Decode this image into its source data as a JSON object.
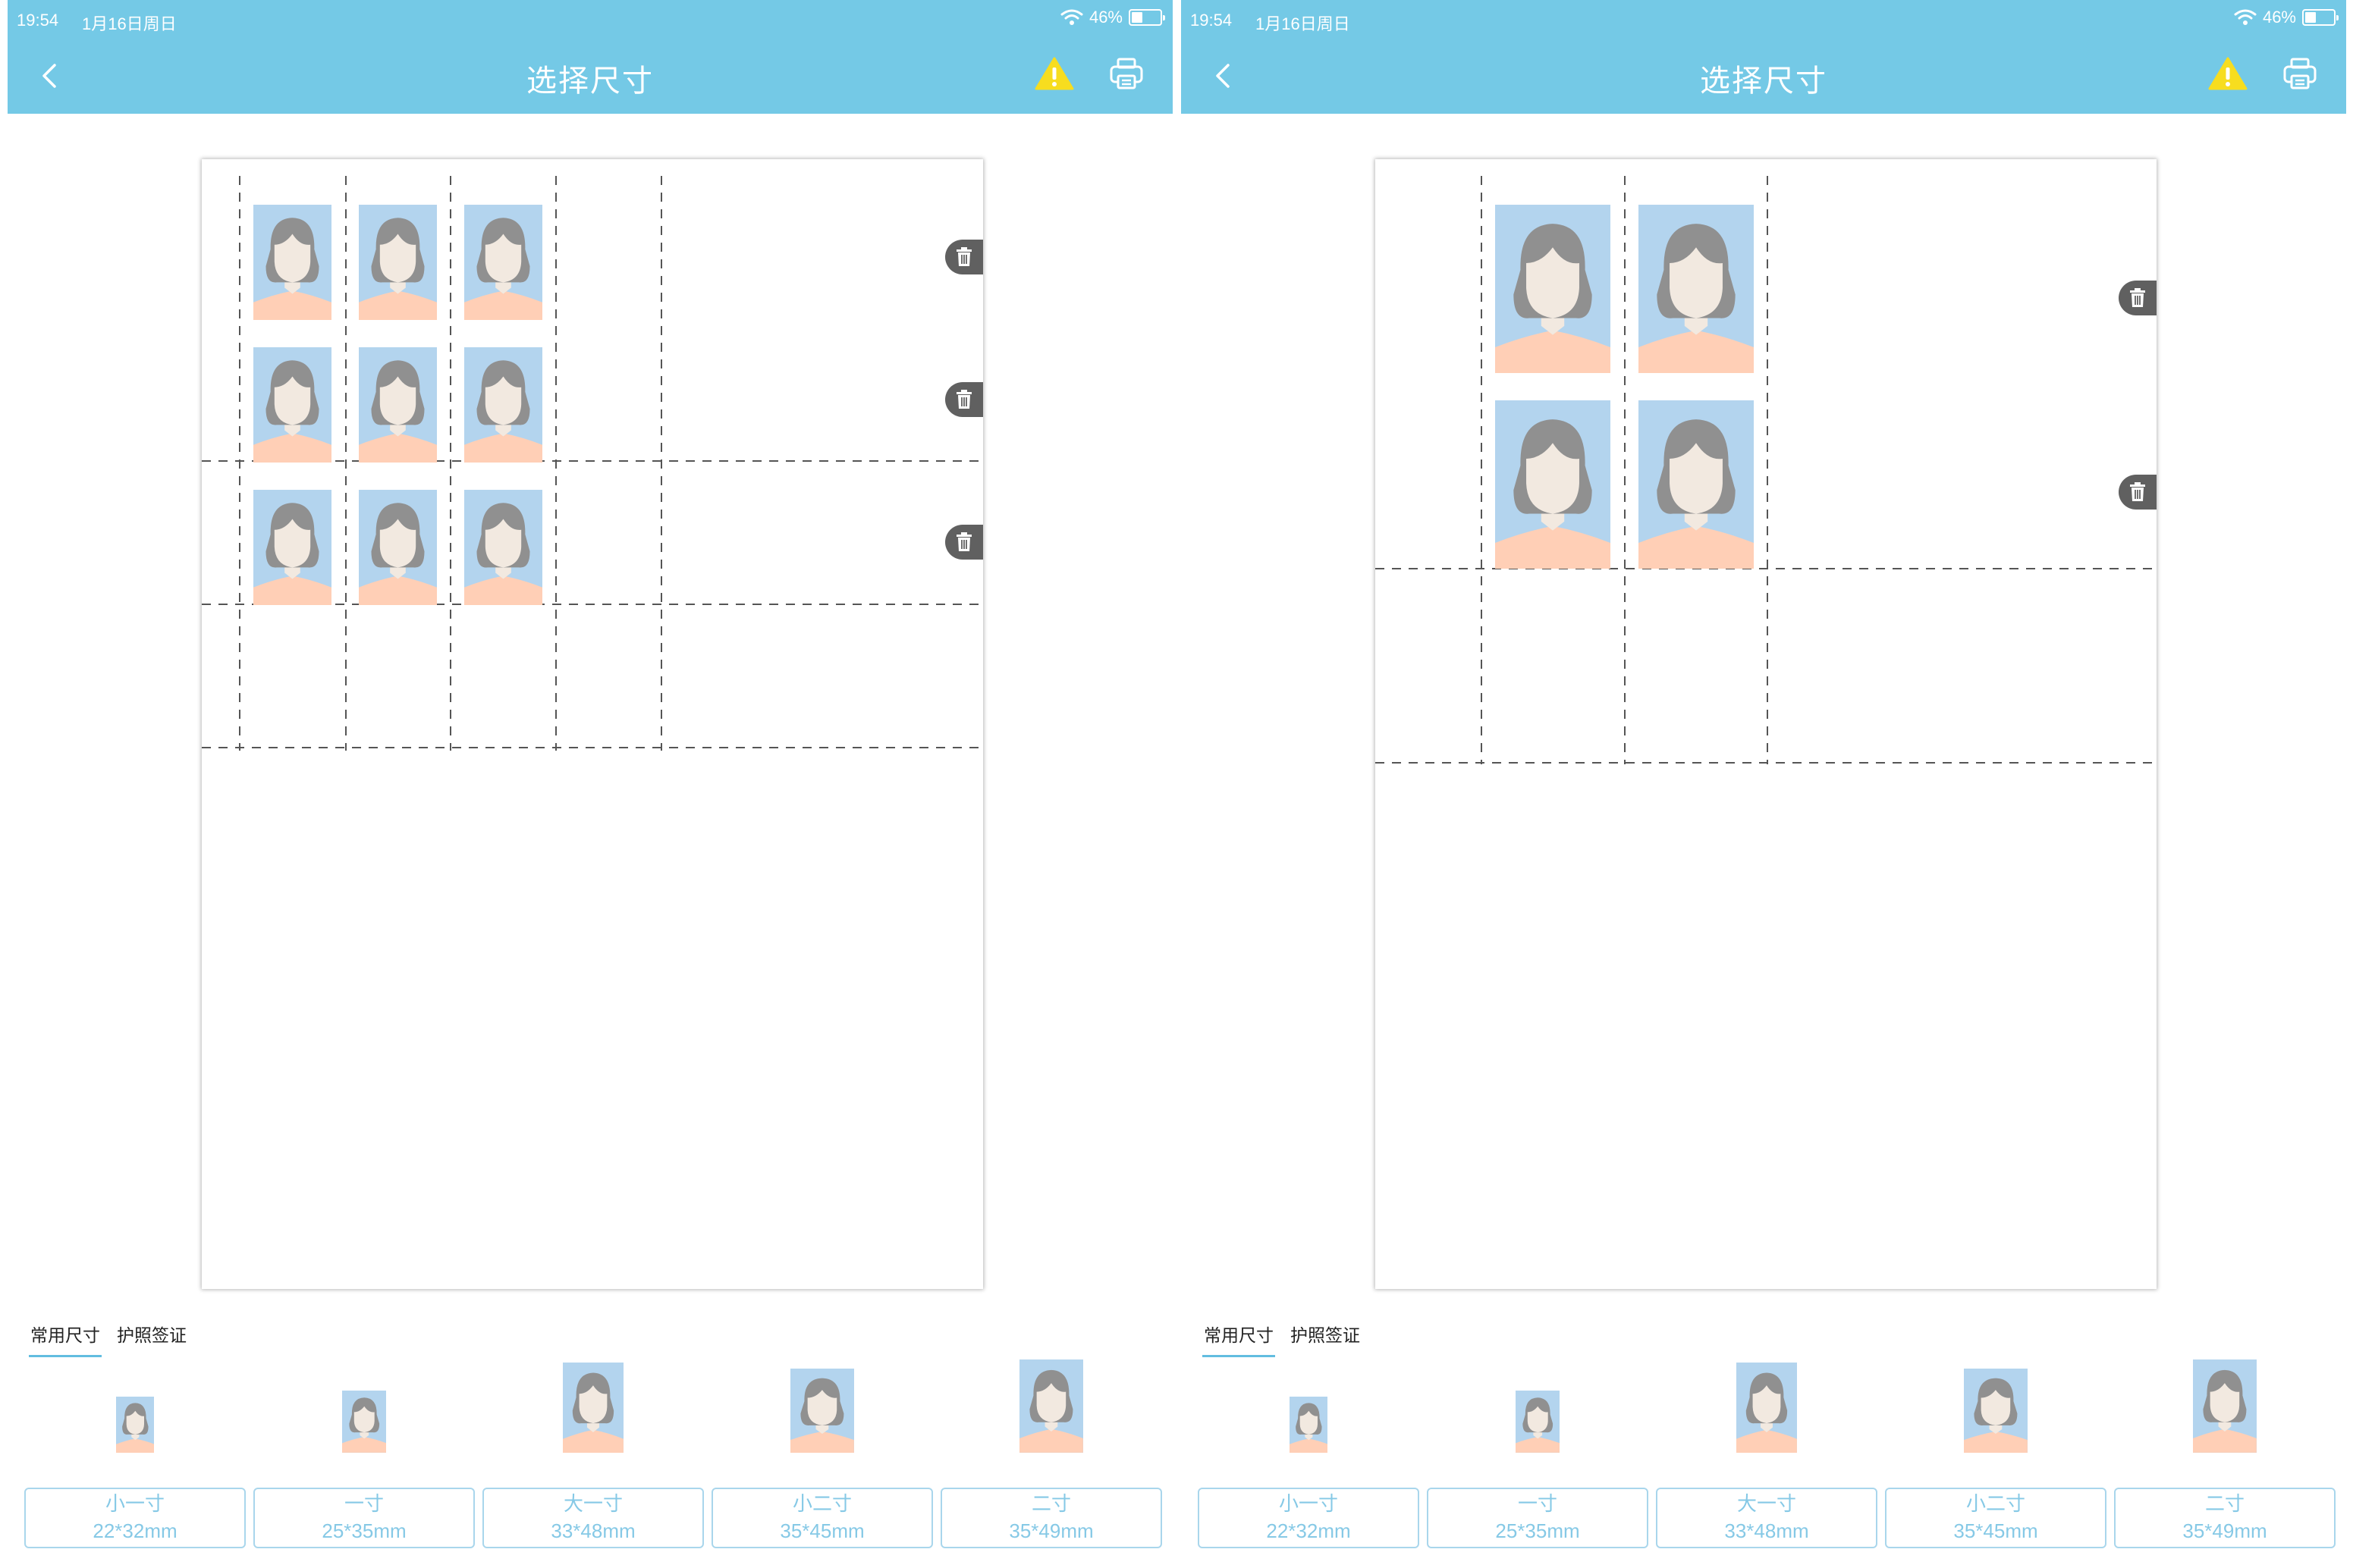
{
  "screens": [
    {
      "status": {
        "time": "19:54",
        "date": "1月16日周日",
        "battery": "46%"
      },
      "nav": {
        "title": "选择尺寸"
      },
      "tabs": [
        {
          "label": "常用尺寸",
          "active": true
        },
        {
          "label": "护照签证",
          "active": false
        }
      ],
      "layout": {
        "rows": 3,
        "cols": 3
      },
      "sizes": [
        {
          "name": "小一寸",
          "dim": "22*32mm"
        },
        {
          "name": "一寸",
          "dim": "25*35mm"
        },
        {
          "name": "大一寸",
          "dim": "33*48mm"
        },
        {
          "name": "小二寸",
          "dim": "35*45mm"
        },
        {
          "name": "二寸",
          "dim": "35*49mm"
        }
      ]
    },
    {
      "status": {
        "time": "19:54",
        "date": "1月16日周日",
        "battery": "46%"
      },
      "nav": {
        "title": "选择尺寸"
      },
      "tabs": [
        {
          "label": "常用尺寸",
          "active": true
        },
        {
          "label": "护照签证",
          "active": false
        }
      ],
      "layout": {
        "rows": 2,
        "cols": 2
      },
      "sizes": [
        {
          "name": "小一寸",
          "dim": "22*32mm"
        },
        {
          "name": "一寸",
          "dim": "25*35mm"
        },
        {
          "name": "大一寸",
          "dim": "33*48mm"
        },
        {
          "name": "小二寸",
          "dim": "35*45mm"
        },
        {
          "name": "二寸",
          "dim": "35*49mm"
        }
      ]
    }
  ],
  "colors": {
    "nav_bar": "#74c9e6",
    "photo_background": "#b3d4ee",
    "hair": "#909090",
    "skin": "#f2e9e0",
    "shirt": "#ffcfb6",
    "size_button_border": "#a9d6ec",
    "size_button_text": "#86c9e6",
    "warning": "#f7dd1f"
  },
  "icons": {
    "back": "chevron-left-icon",
    "warning": "warning-icon",
    "print": "printer-icon",
    "delete_row": "trash-icon",
    "wifi": "wifi-icon",
    "battery": "battery-icon"
  }
}
